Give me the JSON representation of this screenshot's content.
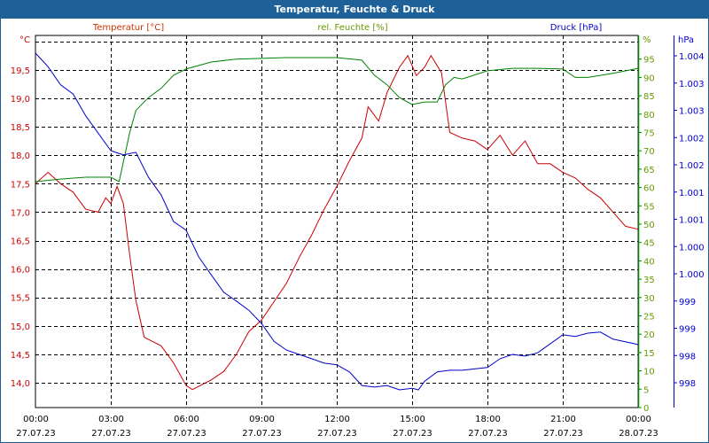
{
  "window": {
    "title": "Temperatur, Feuchte & Druck"
  },
  "colors": {
    "temperature": "#cc0000",
    "humidity": "#008000",
    "pressure": "#0000cc",
    "titlebar": "#1e6198",
    "humidity_label": "#669900"
  },
  "chart_data": {
    "type": "line",
    "title": "Temperatur, Feuchte & Druck",
    "x_range_hours": [
      0,
      24
    ],
    "x_ticks": [
      {
        "h": 0,
        "time": "00:00",
        "date": "27.07.23"
      },
      {
        "h": 3,
        "time": "03:00",
        "date": "27.07.23"
      },
      {
        "h": 6,
        "time": "06:00",
        "date": "27.07.23"
      },
      {
        "h": 9,
        "time": "09:00",
        "date": "27.07.23"
      },
      {
        "h": 12,
        "time": "12:00",
        "date": "27.07.23"
      },
      {
        "h": 15,
        "time": "15:00",
        "date": "27.07.23"
      },
      {
        "h": 18,
        "time": "18:00",
        "date": "27.07.23"
      },
      {
        "h": 21,
        "time": "21:00",
        "date": "27.07.23"
      },
      {
        "h": 24,
        "time": "00:00",
        "date": "28.07.23"
      }
    ],
    "axes": {
      "temperature": {
        "legend": "Temperatur [°C]",
        "unit": "°C",
        "ylim": [
          14.0,
          20.0
        ],
        "ticks": [
          [
            14.0,
            "14,0"
          ],
          [
            14.5,
            "14,5"
          ],
          [
            15.0,
            "15,0"
          ],
          [
            15.5,
            "15,5"
          ],
          [
            16.0,
            "16,0"
          ],
          [
            16.5,
            "16,5"
          ],
          [
            17.0,
            "17,0"
          ],
          [
            17.5,
            "17,5"
          ],
          [
            18.0,
            "18,0"
          ],
          [
            18.5,
            "18,5"
          ],
          [
            19.0,
            "19,0"
          ],
          [
            19.5,
            "19,5"
          ]
        ]
      },
      "humidity": {
        "legend": "rel. Feuchte [%]",
        "unit": "%",
        "ylim": [
          0,
          100
        ],
        "ticks": [
          [
            0,
            "0"
          ],
          [
            5,
            "5"
          ],
          [
            10,
            "10"
          ],
          [
            15,
            "15"
          ],
          [
            20,
            "20"
          ],
          [
            25,
            "25"
          ],
          [
            30,
            "30"
          ],
          [
            35,
            "35"
          ],
          [
            40,
            "40"
          ],
          [
            45,
            "45"
          ],
          [
            50,
            "50"
          ],
          [
            55,
            "55"
          ],
          [
            60,
            "60"
          ],
          [
            65,
            "65"
          ],
          [
            70,
            "70"
          ],
          [
            75,
            "75"
          ],
          [
            80,
            "80"
          ],
          [
            85,
            "85"
          ],
          [
            90,
            "90"
          ],
          [
            95,
            "95"
          ]
        ]
      },
      "pressure": {
        "legend": "Druck [hPa]",
        "unit": "hPa",
        "ylim": [
          998.0,
          1004.0
        ],
        "ticks": [
          [
            998.0,
            "998"
          ],
          [
            998.5,
            "998"
          ],
          [
            999.0,
            "999"
          ],
          [
            999.5,
            "999"
          ],
          [
            1000.0,
            "1.000"
          ],
          [
            1000.5,
            "1.000"
          ],
          [
            1001.0,
            "1.001"
          ],
          [
            1001.5,
            "1.001"
          ],
          [
            1002.0,
            "1.002"
          ],
          [
            1002.5,
            "1.002"
          ],
          [
            1003.0,
            "1.003"
          ],
          [
            1003.5,
            "1.003"
          ],
          [
            1004.0,
            "1.004"
          ]
        ]
      }
    },
    "series": [
      {
        "name": "Temperatur",
        "axis": "temperature",
        "x": [
          0,
          0.5,
          1,
          1.5,
          2,
          2.5,
          2.8,
          3,
          3.25,
          3.5,
          3.75,
          4,
          4.33,
          5,
          5.5,
          6,
          6.25,
          7,
          7.5,
          8,
          8.5,
          9,
          10,
          10.5,
          11,
          11.5,
          12,
          12.5,
          13,
          13.25,
          13.67,
          14,
          14.5,
          14.83,
          15.17,
          15.5,
          15.75,
          16.17,
          16.5,
          17,
          17.5,
          18,
          18.5,
          19,
          19.5,
          20,
          20.5,
          21,
          21.5,
          22,
          22.5,
          23,
          23.5,
          24
        ],
        "y": [
          17.5,
          17.7,
          17.5,
          17.35,
          17.05,
          17.0,
          17.25,
          17.15,
          17.45,
          17.15,
          16.25,
          15.45,
          14.8,
          14.65,
          14.35,
          13.95,
          13.88,
          14.05,
          14.2,
          14.5,
          14.9,
          15.1,
          15.75,
          16.2,
          16.6,
          17.05,
          17.45,
          17.9,
          18.3,
          18.85,
          18.6,
          19.1,
          19.55,
          19.75,
          19.4,
          19.55,
          19.75,
          19.45,
          18.4,
          18.3,
          18.25,
          18.1,
          18.35,
          18.0,
          18.25,
          17.85,
          17.85,
          17.7,
          17.6,
          17.4,
          17.25,
          17.0,
          16.75,
          16.7
        ]
      },
      {
        "name": "rel. Feuchte",
        "axis": "humidity",
        "x": [
          0,
          1,
          2,
          3,
          3.33,
          3.75,
          4,
          4.5,
          5,
          5.5,
          6,
          7,
          8,
          10,
          12,
          13,
          13.5,
          14,
          14.5,
          15,
          15.5,
          16,
          16.33,
          16.67,
          17,
          18,
          19,
          20,
          21,
          21.5,
          22,
          23,
          24
        ],
        "y": [
          61.6,
          62.3,
          62.8,
          62.8,
          61.6,
          74.9,
          81,
          84.5,
          87,
          90.6,
          92.3,
          94.2,
          95,
          95.4,
          95.4,
          94.7,
          90.6,
          88,
          84.5,
          82.6,
          83.3,
          83.3,
          88,
          90,
          89.6,
          91.8,
          92.5,
          92.5,
          92.3,
          90,
          90,
          91.1,
          92.5
        ]
      },
      {
        "name": "Druck",
        "axis": "pressure",
        "x": [
          0,
          0.5,
          1,
          1.5,
          2,
          2.5,
          3,
          3.5,
          4,
          4.5,
          5,
          5.5,
          6,
          6.5,
          7,
          7.5,
          8,
          8.5,
          9,
          9.5,
          10,
          10.5,
          11,
          11.5,
          12,
          12.5,
          13,
          13.5,
          14,
          14.5,
          15,
          15.25,
          15.5,
          16,
          16.5,
          17,
          18,
          18.5,
          19,
          19.5,
          20,
          21,
          21.5,
          22,
          22.5,
          23,
          24
        ],
        "y": [
          1004.05,
          1003.8,
          1003.47,
          1003.3,
          1002.9,
          1002.58,
          1002.26,
          1002.18,
          1002.23,
          1001.77,
          1001.45,
          1000.96,
          1000.8,
          1000.31,
          999.98,
          999.66,
          999.5,
          999.33,
          999.09,
          998.76,
          998.6,
          998.52,
          998.44,
          998.36,
          998.33,
          998.2,
          997.95,
          997.92,
          997.95,
          997.87,
          997.9,
          997.87,
          998.03,
          998.2,
          998.23,
          998.23,
          998.28,
          998.44,
          998.52,
          998.49,
          998.55,
          998.88,
          998.85,
          998.91,
          998.93,
          998.8,
          998.7
        ]
      }
    ],
    "grid": true,
    "legend": "top"
  }
}
